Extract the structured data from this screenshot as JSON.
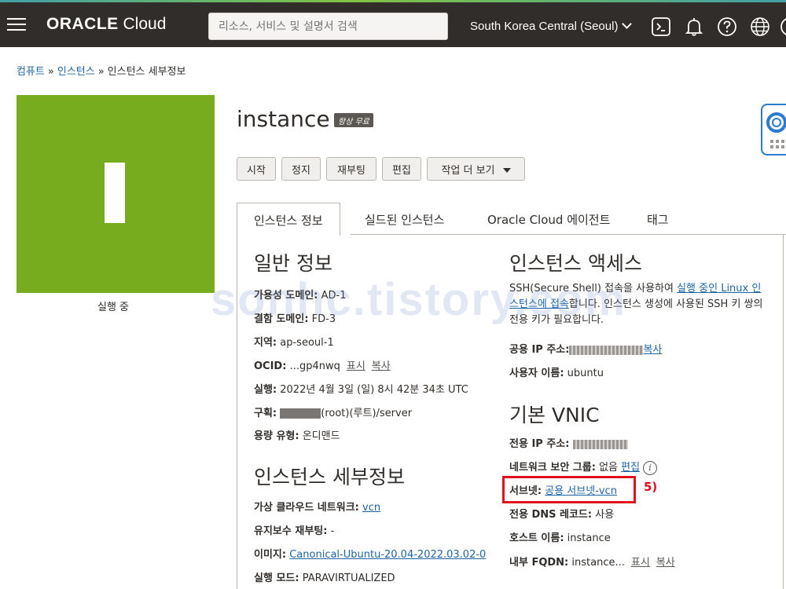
{
  "header": {
    "logo_brand": "ORACLE",
    "logo_product": "Cloud",
    "search_placeholder": "리소스, 서비스 및 설명서 검색",
    "region": "South Korea Central (Seoul)"
  },
  "breadcrumb": {
    "items": [
      "컴퓨트",
      "인스턴스",
      "인스턴스 세부정보"
    ],
    "separator": "»"
  },
  "instance": {
    "icon_letter": "I",
    "tile_color": "#76ac1e",
    "status": "실행 중",
    "name": "instance",
    "badge": "항상 무료"
  },
  "actions": {
    "start": "시작",
    "stop": "정지",
    "reboot": "재부팅",
    "edit": "편집",
    "more": "작업 더 보기"
  },
  "tabs": [
    "인스턴스 정보",
    "실드된 인스턴스",
    "Oracle Cloud 에이전트",
    "태그"
  ],
  "general": {
    "heading": "일반 정보",
    "ad_label": "가용성 도메인:",
    "ad_value": "AD-1",
    "fd_label": "결함 도메인:",
    "fd_value": "FD-3",
    "region_label": "지역:",
    "region_value": "ap-seoul-1",
    "ocid_label": "OCID:",
    "ocid_value": "...gp4nwq",
    "show": "표시",
    "copy": "복사",
    "launched_label": "실행:",
    "launched_value": "2022년 4월 3일 (일) 8시 42분 34초 UTC",
    "compartment_label": "구획:",
    "compartment_value": "(root)(루트)/server",
    "capacity_label": "용량 유형:",
    "capacity_value": "온디맨드"
  },
  "details": {
    "heading": "인스턴스 세부정보",
    "vcn_label": "가상 클라우드 네트워크:",
    "vcn_value": "vcn",
    "maintenance_label": "유지보수 재부팅:",
    "maintenance_value": "-",
    "image_label": "이미지:",
    "image_value": "Canonical-Ubuntu-20.04-2022.03.02-0",
    "mode_label": "실행 모드:",
    "mode_value": "PARAVIRTUALIZED"
  },
  "access": {
    "heading": "인스턴스 액세스",
    "text1": "SSH(Secure Shell) 접속을 사용하여 ",
    "link": "실행 중인 Linux 인스턴스에 접속",
    "text2": "합니다. 인스턴스 생성에 사용된 SSH 키 쌍의 전용 키가 필요합니다.",
    "public_ip_label": "공용 IP 주소:",
    "copy": "복사",
    "username_label": "사용자 이름:",
    "username_value": "ubuntu"
  },
  "vnic": {
    "heading": "기본 VNIC",
    "private_ip_label": "전용 IP 주소:",
    "nsg_label": "네트워크 보안 그룹:",
    "nsg_value": "없음",
    "nsg_edit": "편집",
    "subnet_label": "서브넷:",
    "subnet_value": "공용 서브넷-vcn",
    "dns_label": "전용 DNS 레코드:",
    "dns_value": "사용",
    "hostname_label": "호스트 이름:",
    "hostname_value": "instance",
    "fqdn_label": "내부 FQDN:",
    "fqdn_value": "instance...",
    "show": "표시",
    "copy": "복사"
  },
  "annotation": {
    "step": "5)",
    "color": "#e0101e"
  },
  "watermark": "sonhc.tistory.com"
}
